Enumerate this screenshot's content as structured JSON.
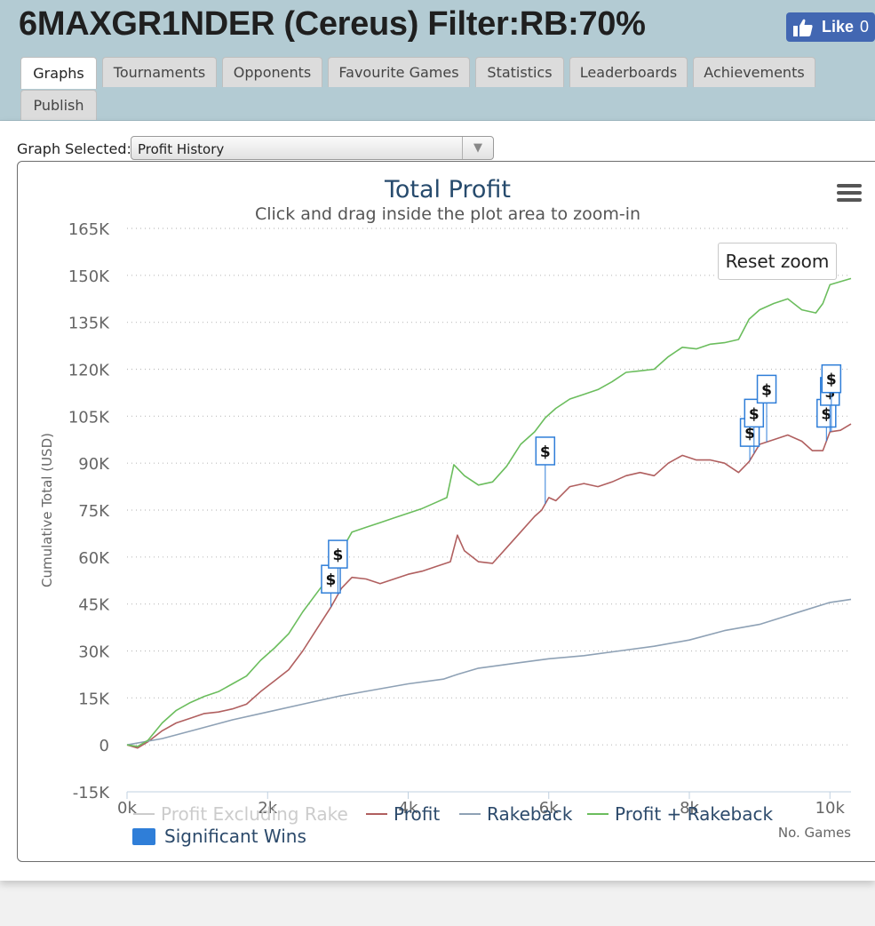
{
  "page_title": "6MAXGR1NDER (Cereus) Filter:RB:70%",
  "like": {
    "label": "Like",
    "count": "0"
  },
  "tabs": [
    {
      "label": "Graphs",
      "active": true
    },
    {
      "label": "Tournaments"
    },
    {
      "label": "Opponents"
    },
    {
      "label": "Favourite Games"
    },
    {
      "label": "Statistics"
    },
    {
      "label": "Leaderboards"
    },
    {
      "label": "Achievements"
    },
    {
      "label": "Publish"
    }
  ],
  "graph_selector": {
    "label": "Graph Selected:",
    "value": "Profit History"
  },
  "chart_controls": {
    "reset_zoom": "Reset zoom",
    "menu_icon": "hamburger-menu-icon"
  },
  "colors": {
    "profit": "#b05f5f",
    "rakeback": "#8ea1b5",
    "profit_plus_rakeback": "#6bbd5d",
    "significant_wins": "#2f7ed8",
    "title": "#274b6d"
  },
  "chart_data": {
    "type": "line",
    "title": "Total Profit",
    "subtitle": "Click and drag inside the plot area to zoom-in",
    "xlabel": "No. Games",
    "ylabel": "Cumulative Total (USD)",
    "xlim": [
      0,
      10300
    ],
    "ylim": [
      -15000,
      165000
    ],
    "x_ticks": [
      0,
      2000,
      4000,
      6000,
      8000,
      10000
    ],
    "x_tick_labels": [
      "0k",
      "2k",
      "4k",
      "6k",
      "8k",
      "10k"
    ],
    "y_ticks": [
      -15000,
      0,
      15000,
      30000,
      45000,
      60000,
      75000,
      90000,
      105000,
      120000,
      135000,
      150000,
      165000
    ],
    "y_tick_labels": [
      "-15K",
      "0",
      "15K",
      "30K",
      "45K",
      "60K",
      "75K",
      "90K",
      "105K",
      "120K",
      "135K",
      "150K",
      "165K"
    ],
    "grid": true,
    "legend_position": "bottom-left",
    "series": [
      {
        "name": "Profit Excluding Rake",
        "visible": false,
        "points": []
      },
      {
        "name": "Profit",
        "points": [
          [
            0,
            0
          ],
          [
            150,
            -1000
          ],
          [
            300,
            1000
          ],
          [
            500,
            4500
          ],
          [
            700,
            7000
          ],
          [
            900,
            8500
          ],
          [
            1100,
            10000
          ],
          [
            1300,
            10500
          ],
          [
            1500,
            11500
          ],
          [
            1700,
            13000
          ],
          [
            1900,
            17000
          ],
          [
            2100,
            20500
          ],
          [
            2300,
            24000
          ],
          [
            2500,
            30000
          ],
          [
            2700,
            37000
          ],
          [
            2900,
            44000
          ],
          [
            3050,
            50000
          ],
          [
            3200,
            53500
          ],
          [
            3400,
            53000
          ],
          [
            3600,
            51500
          ],
          [
            3800,
            53000
          ],
          [
            4000,
            54500
          ],
          [
            4200,
            55500
          ],
          [
            4400,
            57000
          ],
          [
            4600,
            58500
          ],
          [
            4700,
            67000
          ],
          [
            4800,
            62000
          ],
          [
            5000,
            58500
          ],
          [
            5200,
            58000
          ],
          [
            5400,
            63000
          ],
          [
            5600,
            68000
          ],
          [
            5800,
            73000
          ],
          [
            5900,
            75000
          ],
          [
            6000,
            79000
          ],
          [
            6100,
            78000
          ],
          [
            6300,
            82500
          ],
          [
            6500,
            83500
          ],
          [
            6700,
            82500
          ],
          [
            6900,
            84000
          ],
          [
            7100,
            86000
          ],
          [
            7300,
            87000
          ],
          [
            7500,
            86000
          ],
          [
            7700,
            90000
          ],
          [
            7900,
            92500
          ],
          [
            8100,
            91000
          ],
          [
            8300,
            91000
          ],
          [
            8500,
            90000
          ],
          [
            8700,
            87000
          ],
          [
            8850,
            90500
          ],
          [
            9000,
            96000
          ],
          [
            9200,
            97500
          ],
          [
            9400,
            99000
          ],
          [
            9600,
            97000
          ],
          [
            9750,
            94000
          ],
          [
            9900,
            94000
          ],
          [
            10000,
            100000
          ],
          [
            10150,
            100500
          ],
          [
            10300,
            102500
          ]
        ]
      },
      {
        "name": "Rakeback",
        "points": [
          [
            0,
            0
          ],
          [
            500,
            2000
          ],
          [
            1000,
            5000
          ],
          [
            1500,
            8000
          ],
          [
            2000,
            10500
          ],
          [
            2500,
            13000
          ],
          [
            3000,
            15500
          ],
          [
            3500,
            17500
          ],
          [
            4000,
            19500
          ],
          [
            4500,
            21000
          ],
          [
            4700,
            22500
          ],
          [
            5000,
            24500
          ],
          [
            5500,
            26000
          ],
          [
            6000,
            27500
          ],
          [
            6500,
            28500
          ],
          [
            7000,
            30000
          ],
          [
            7500,
            31500
          ],
          [
            8000,
            33500
          ],
          [
            8500,
            36500
          ],
          [
            9000,
            38500
          ],
          [
            9500,
            42000
          ],
          [
            10000,
            45500
          ],
          [
            10300,
            46500
          ]
        ]
      },
      {
        "name": "Profit + Rakeback",
        "points": [
          [
            0,
            0
          ],
          [
            150,
            -500
          ],
          [
            300,
            1500
          ],
          [
            500,
            7000
          ],
          [
            700,
            11000
          ],
          [
            900,
            13500
          ],
          [
            1100,
            15500
          ],
          [
            1300,
            17000
          ],
          [
            1500,
            19500
          ],
          [
            1700,
            22000
          ],
          [
            1900,
            27000
          ],
          [
            2100,
            31000
          ],
          [
            2300,
            35500
          ],
          [
            2500,
            42500
          ],
          [
            2700,
            48500
          ],
          [
            2900,
            54500
          ],
          [
            3050,
            62000
          ],
          [
            3200,
            68000
          ],
          [
            3400,
            69500
          ],
          [
            3600,
            71000
          ],
          [
            3800,
            72500
          ],
          [
            4000,
            74000
          ],
          [
            4200,
            75500
          ],
          [
            4400,
            77500
          ],
          [
            4550,
            79000
          ],
          [
            4650,
            89500
          ],
          [
            4800,
            86000
          ],
          [
            5000,
            83000
          ],
          [
            5200,
            84000
          ],
          [
            5400,
            89000
          ],
          [
            5600,
            96000
          ],
          [
            5800,
            100000
          ],
          [
            5950,
            104500
          ],
          [
            6100,
            107500
          ],
          [
            6300,
            110500
          ],
          [
            6500,
            112000
          ],
          [
            6700,
            113500
          ],
          [
            6900,
            116000
          ],
          [
            7100,
            119000
          ],
          [
            7300,
            119500
          ],
          [
            7500,
            120000
          ],
          [
            7700,
            124000
          ],
          [
            7900,
            127000
          ],
          [
            8100,
            126500
          ],
          [
            8300,
            128000
          ],
          [
            8500,
            128500
          ],
          [
            8700,
            129500
          ],
          [
            8850,
            136000
          ],
          [
            9000,
            139000
          ],
          [
            9200,
            141000
          ],
          [
            9400,
            142500
          ],
          [
            9600,
            139000
          ],
          [
            9800,
            138000
          ],
          [
            9900,
            141000
          ],
          [
            10000,
            147000
          ],
          [
            10150,
            148000
          ],
          [
            10300,
            149000
          ]
        ]
      }
    ],
    "significant_wins": {
      "name": "Significant Wins",
      "label": "$",
      "x": [
        2900,
        3000,
        5950,
        8860,
        8920,
        9100,
        9950,
        10000,
        10020
      ]
    }
  }
}
